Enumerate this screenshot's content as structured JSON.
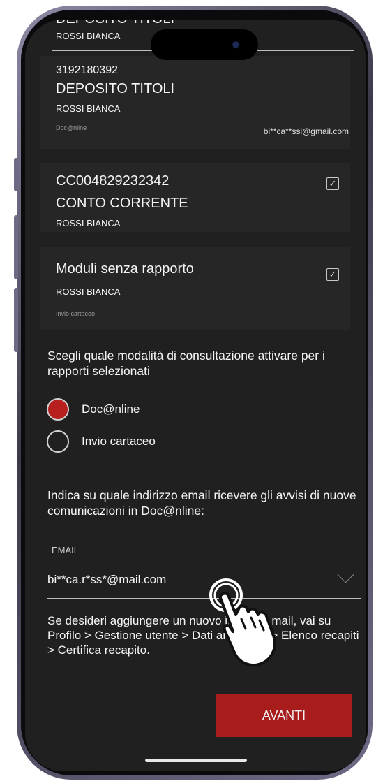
{
  "top_card": {
    "title_partial": "DEPOSITO TITOLI",
    "owner": "ROSSI BIANCA"
  },
  "accounts": [
    {
      "number": "3192180392",
      "type": "DEPOSITO TITOLI",
      "owner": "ROSSI BIANCA",
      "mode": "Doc@nline",
      "email": "bi**ca**ssi@gmail.com"
    },
    {
      "number": "CC004829232342",
      "type": "CONTO CORRENTE",
      "owner": "ROSSI BIANCA",
      "checked": true
    },
    {
      "title": "Moduli senza rapporto",
      "owner": "ROSSI BIANCA",
      "mode": "Invio cartaceo",
      "checked": true
    }
  ],
  "consultation": {
    "prompt": "Scegli quale modalità di consultazione attivare per i rapporti selezionati",
    "options": [
      {
        "label": "Doc@nline",
        "selected": true
      },
      {
        "label": "Invio cartaceo",
        "selected": false
      }
    ]
  },
  "email_section": {
    "prompt": "Indica su quale indirizzo email ricevere gli avvisi di nuove comunicazioni in Doc@nline:",
    "field_label": "EMAIL",
    "field_value": "bi**ca.r*ss*@mail.com",
    "hint": "Se desideri aggiungere un nuovo indirizzo mail, vai su Profilo > Gestione utente > Dati anagrafici > Elenco recapiti > Certifica recapito."
  },
  "next_button": "AVANTI",
  "colors": {
    "accent": "#b81f1f",
    "button": "#a81c1c",
    "background": "#202020",
    "card": "#262626"
  },
  "icons": {
    "checkbox": "check-icon",
    "select": "chevron-down-icon",
    "pointer": "hand-pointer-icon"
  }
}
